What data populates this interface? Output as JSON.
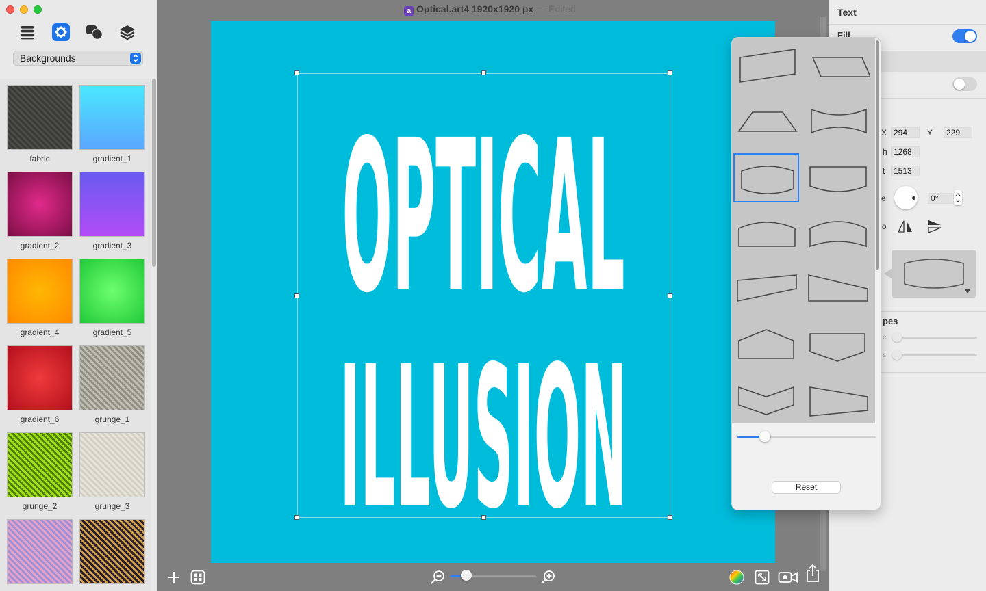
{
  "window": {
    "title": "Optical.art4 1920x1920 px",
    "edited": "Edited",
    "app_icon": "a"
  },
  "sidebar": {
    "category": "Backgrounds",
    "tools": [
      "list-icon",
      "gear-icon",
      "shapes-icon",
      "layers-icon"
    ],
    "backgrounds": [
      {
        "label": "fabric",
        "colors": [
          "#3a3b36",
          "#4e4f48"
        ]
      },
      {
        "label": "gradient_1",
        "colors": [
          "#4ae8ff",
          "#5aa6ff"
        ]
      },
      {
        "label": "gradient_2",
        "colors": [
          "#e12a8a",
          "#7c0f46"
        ]
      },
      {
        "label": "gradient_3",
        "colors": [
          "#6a5bf0",
          "#b24cf7"
        ]
      },
      {
        "label": "gradient_4",
        "colors": [
          "#ffb703",
          "#ff8a00"
        ]
      },
      {
        "label": "gradient_5",
        "colors": [
          "#6dff6d",
          "#22c93a"
        ]
      },
      {
        "label": "gradient_6",
        "colors": [
          "#ef3b3b",
          "#b3101d"
        ]
      },
      {
        "label": "grunge_1",
        "colors": [
          "#bfbdb0",
          "#8f8e84"
        ]
      },
      {
        "label": "grunge_2",
        "colors": [
          "#a3e01b",
          "#4d7f0c"
        ]
      },
      {
        "label": "grunge_3",
        "colors": [
          "#e6e3da",
          "#d2cec2"
        ]
      },
      {
        "label": "",
        "colors": [
          "#e7a3c7",
          "#9c8fd8"
        ]
      },
      {
        "label": "",
        "colors": [
          "#2a1f29",
          "#d0a050"
        ]
      }
    ]
  },
  "canvas": {
    "background": "#00bcdb",
    "text_line1": "OPTICAL",
    "text_line2": "ILLUSION",
    "text_color": "#ffffff",
    "zoom_fraction": 0.18
  },
  "bottom_toolbar": [
    "add-icon",
    "grid-icon",
    "zoom-out-icon",
    "zoom-in-icon",
    "color-wheel-icon",
    "fit-screen-icon",
    "video-icon",
    "share-icon"
  ],
  "inspector": {
    "title": "Text",
    "fill_label": "Fill",
    "fill_on": true,
    "toggle2_on": false,
    "x_label": "X",
    "x_value": "294",
    "y_label": "Y",
    "y_value": "229",
    "w_label": "h",
    "w_value": "1268",
    "h_label": "t",
    "h_value": "1513",
    "angle_label": "e",
    "angle_value": "0°",
    "flip_label": "o",
    "shapes_label": "pes",
    "slider1_label": "e",
    "slider2_label": "s"
  },
  "popover": {
    "shapes": [
      "perspective-right",
      "parallelogram",
      "trapezoid",
      "concave-wave",
      "bulge-selected",
      "arch-bottom",
      "arch-top",
      "arc",
      "wedge-right",
      "wedge-left",
      "house",
      "shield",
      "chevron",
      "taper-left"
    ],
    "selected_index": 4,
    "slider_fraction": 0.2,
    "reset_label": "Reset"
  }
}
